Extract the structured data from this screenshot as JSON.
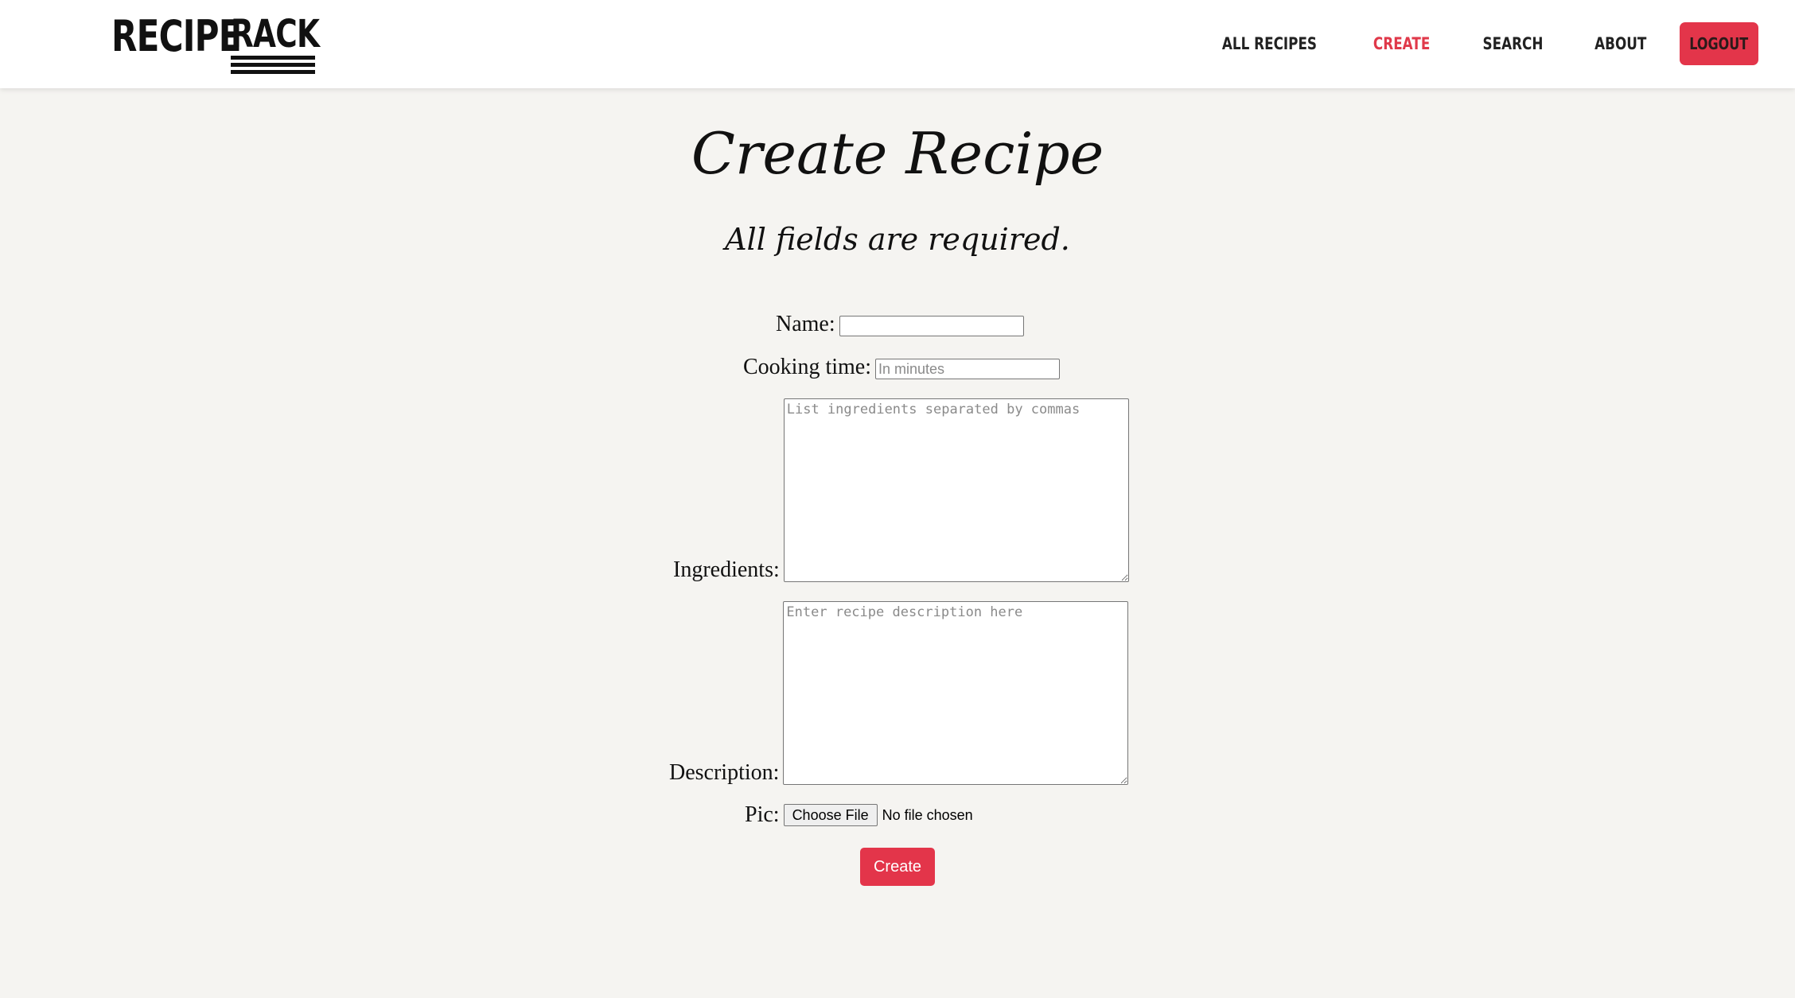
{
  "brand": {
    "word1": "RECIPE",
    "word2": "RACK"
  },
  "nav": {
    "items": [
      {
        "label": "ALL RECIPES",
        "active": false
      },
      {
        "label": "CREATE",
        "active": true
      },
      {
        "label": "SEARCH",
        "active": false
      },
      {
        "label": "ABOUT",
        "active": false
      }
    ],
    "logout_label": "LOGOUT"
  },
  "page": {
    "title": "Create Recipe",
    "subtitle": "All fields are required."
  },
  "form": {
    "name_label": "Name:",
    "name_value": "",
    "cooking_time_label": "Cooking time:",
    "cooking_time_placeholder": "In minutes",
    "ingredients_label": "Ingredients:",
    "ingredients_placeholder": "List ingredients separated by commas",
    "description_label": "Description:",
    "description_placeholder": "Enter recipe description here",
    "pic_label": "Pic:",
    "file_button_label": "Choose File",
    "file_status": "No file chosen",
    "submit_label": "Create"
  },
  "colors": {
    "accent": "#e3354a",
    "background": "#f5f4f1",
    "navbar": "#ffffff"
  }
}
